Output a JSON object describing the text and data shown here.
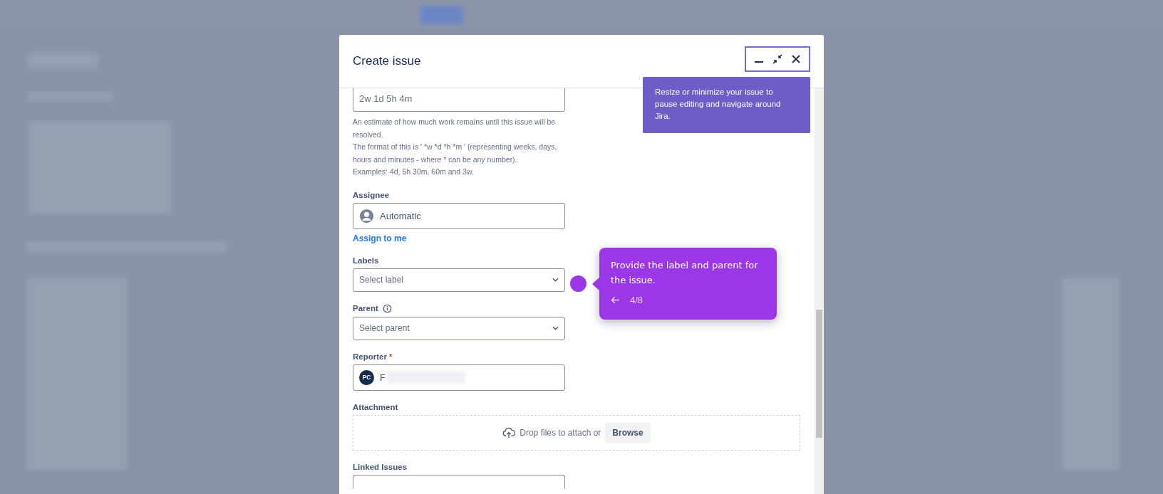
{
  "dialog": {
    "title": "Create issue",
    "controls_tip": "Resize or minimize your issue to pause editing and navigate around Jira.",
    "fields": [
      {
        "kind": "text",
        "value": "2w 1d 5h 4m",
        "help": [
          "An estimate of how much work remains until this issue will be resolved.",
          "The format of this is ' *w *d *h *m ' (representing weeks, days, hours and minutes - where * can be any number).",
          "Examples: 4d, 5h 30m, 60m and 3w."
        ]
      },
      {
        "kind": "user",
        "label": "Assignee",
        "value": "Automatic",
        "link": "Assign to me"
      },
      {
        "kind": "select",
        "label": "Labels",
        "placeholder": "Select label"
      },
      {
        "kind": "select",
        "label": "Parent",
        "info": true,
        "placeholder": "Select parent"
      },
      {
        "kind": "user",
        "label": "Reporter",
        "required_mark": "*",
        "initials": "PC",
        "value": "F",
        "redacted": true
      },
      {
        "kind": "attachment",
        "label": "Attachment",
        "prompt": "Drop files to attach or",
        "button": "Browse"
      },
      {
        "kind": "text",
        "label": "Linked Issues"
      }
    ]
  },
  "tour": {
    "text": "Provide the label and parent for the issue.",
    "step": "4/8"
  }
}
